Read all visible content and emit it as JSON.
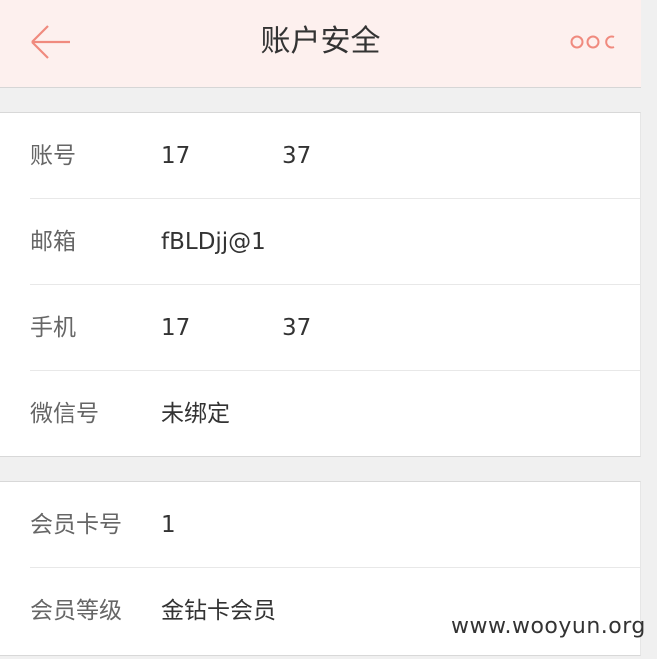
{
  "header": {
    "title": "账户安全",
    "back_icon": "arrow-left-icon",
    "more_icon": "more-dots-icon",
    "accent_color": "#f08a7e",
    "background_color": "#fdf0ee"
  },
  "account_section": {
    "rows": [
      {
        "label": "账号",
        "value": "17",
        "value_tail": "37"
      },
      {
        "label": "邮箱",
        "value": "fBLDjj@1",
        "value_tail": ""
      },
      {
        "label": "手机",
        "value": "17",
        "value_tail": "37"
      },
      {
        "label": "微信号",
        "value": "未绑定",
        "value_tail": ""
      }
    ]
  },
  "member_section": {
    "rows": [
      {
        "label": "会员卡号",
        "value": "1"
      },
      {
        "label": "会员等级",
        "value": "金钻卡会员"
      }
    ]
  },
  "watermark": "www.wooyun.org"
}
